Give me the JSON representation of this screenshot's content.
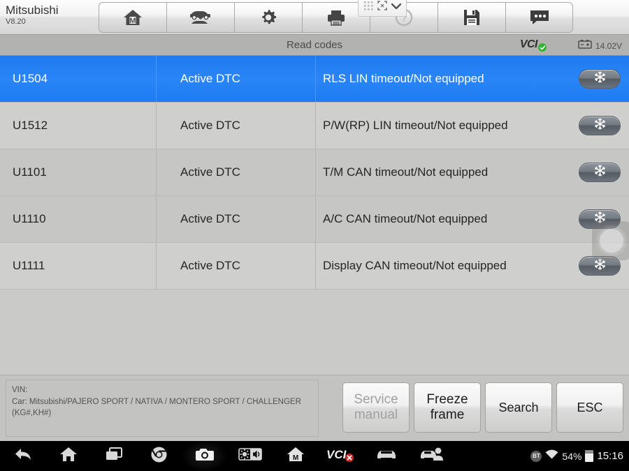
{
  "toolbar": {
    "brand": "Mitsubishi",
    "version": "V8.20",
    "buttons": [
      {
        "name": "home-m-icon",
        "label": "Home"
      },
      {
        "name": "vehicle-swap-icon",
        "label": "Vehicle"
      },
      {
        "name": "gear-icon",
        "label": "Settings"
      },
      {
        "name": "printer-icon",
        "label": "Print"
      },
      {
        "name": "help-icon",
        "label": "Help"
      },
      {
        "name": "save-icon",
        "label": "Save"
      },
      {
        "name": "chat-icon",
        "label": "Feedback"
      }
    ],
    "float_controls": [
      "grid-icon",
      "expand-icon",
      "chevron-down-icon"
    ]
  },
  "titlebar": {
    "title": "Read codes",
    "vci_label": "VCI",
    "vci_status": "connected",
    "voltage": "14.02V"
  },
  "table": {
    "rows": [
      {
        "code": "U1504",
        "status": "Active DTC",
        "description": "RLS LIN timeout/Not equipped",
        "selected": true
      },
      {
        "code": "U1512",
        "status": "Active DTC",
        "description": "P/W(RP) LIN timeout/Not equipped",
        "selected": false
      },
      {
        "code": "U1101",
        "status": "Active DTC",
        "description": "T/M CAN timeout/Not equipped",
        "selected": false
      },
      {
        "code": "U1110",
        "status": "Active DTC",
        "description": "A/C CAN timeout/Not equipped",
        "selected": false
      },
      {
        "code": "U1111",
        "status": "Active DTC",
        "description": "Display CAN timeout/Not equipped",
        "selected": false
      }
    ],
    "freeze_icon": "snowflake-icon"
  },
  "info": {
    "vin_label": "VIN:",
    "car_line1": "Car: Mitsubishi/PAJERO SPORT / NATIVA / MONTERO SPORT / CHALLENGER",
    "car_line2": "(KG#,KH#)"
  },
  "actions": {
    "service_manual": "Service manual",
    "freeze_frame": "Freeze frame",
    "search": "Search",
    "esc": "ESC"
  },
  "navbar": {
    "items": [
      {
        "name": "back-icon"
      },
      {
        "name": "home-icon"
      },
      {
        "name": "recents-icon"
      },
      {
        "name": "chrome-icon"
      },
      {
        "name": "camera-icon"
      },
      {
        "name": "brightness-volume-icon"
      },
      {
        "name": "app-m-icon"
      },
      {
        "name": "vci-disconnected-icon"
      },
      {
        "name": "car-icon"
      },
      {
        "name": "car-service-icon"
      }
    ],
    "vci_label": "VCI",
    "bt_label": "BT",
    "battery_percent": "54%",
    "time": "15:16"
  },
  "colors": {
    "selected_row": "#2a86f7",
    "vci_ok": "#2fb62f",
    "vci_error": "#d02020",
    "panel_bg": "#c3c3c1"
  }
}
